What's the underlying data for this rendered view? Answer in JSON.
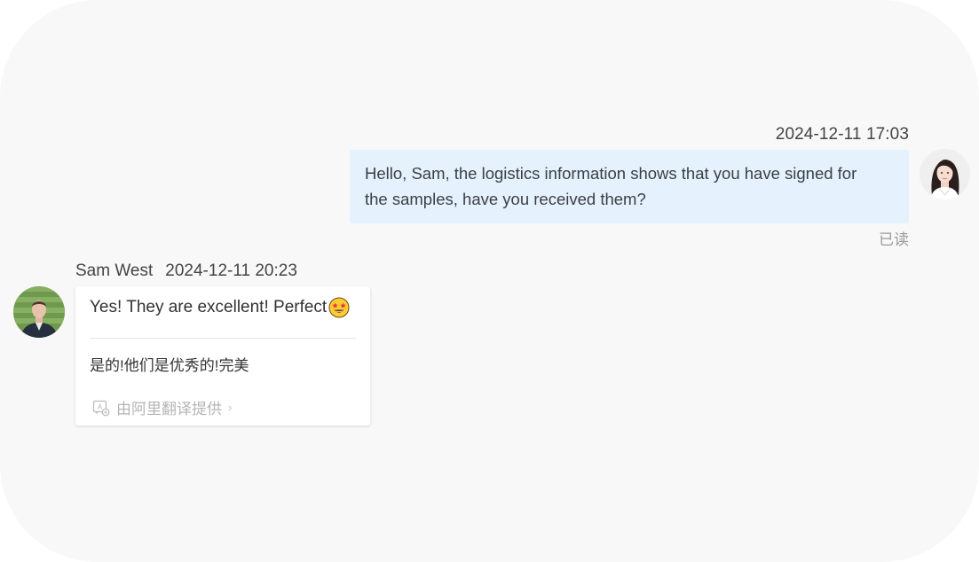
{
  "outgoing": {
    "timestamp": "2024-12-11 17:03",
    "line1": "Hello, Sam, the logistics information shows that you have signed for",
    "line2": "the samples, have you received them?",
    "status": "已读",
    "avatar_icon": "female-user-avatar"
  },
  "incoming": {
    "sender": "Sam West",
    "timestamp": "2024-12-11 20:23",
    "text": "Yes! They are excellent! Perfect",
    "emoji": "star-struck-emoji",
    "translation": "是的!他们是优秀的!完美",
    "provider": "由阿里翻译提供",
    "provider_chevron": "›",
    "avatar_icon": "male-user-avatar"
  },
  "colors": {
    "background": "#f8f8f8",
    "outgoing_bubble": "#e5f1fd",
    "incoming_card": "#ffffff",
    "muted_text": "#9a9a9a"
  }
}
